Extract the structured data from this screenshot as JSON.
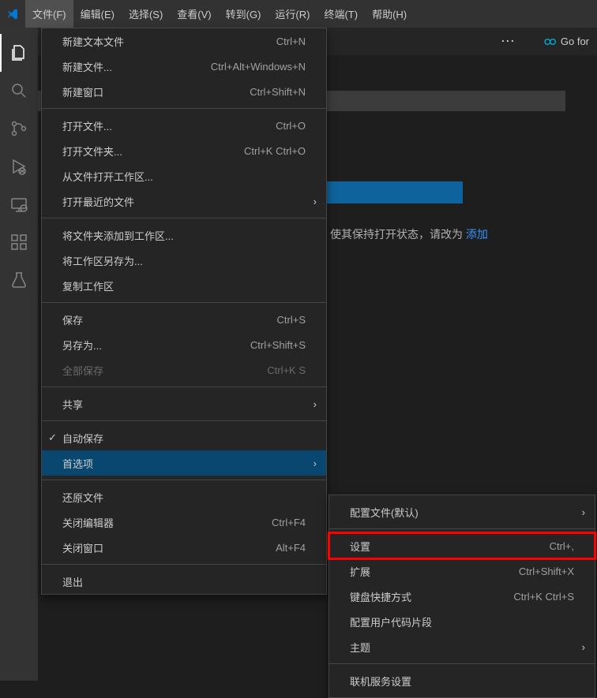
{
  "menubar": {
    "items": [
      {
        "label": "文件(F)"
      },
      {
        "label": "编辑(E)"
      },
      {
        "label": "选择(S)"
      },
      {
        "label": "查看(V)"
      },
      {
        "label": "转到(G)"
      },
      {
        "label": "运行(R)"
      },
      {
        "label": "终端(T)"
      },
      {
        "label": "帮助(H)"
      }
    ]
  },
  "file_menu": {
    "groups": [
      [
        {
          "label": "新建文本文件",
          "shortcut": "Ctrl+N"
        },
        {
          "label": "新建文件...",
          "shortcut": "Ctrl+Alt+Windows+N"
        },
        {
          "label": "新建窗口",
          "shortcut": "Ctrl+Shift+N"
        }
      ],
      [
        {
          "label": "打开文件...",
          "shortcut": "Ctrl+O"
        },
        {
          "label": "打开文件夹...",
          "shortcut": "Ctrl+K Ctrl+O"
        },
        {
          "label": "从文件打开工作区..."
        },
        {
          "label": "打开最近的文件",
          "submenu": true
        }
      ],
      [
        {
          "label": "将文件夹添加到工作区..."
        },
        {
          "label": "将工作区另存为..."
        },
        {
          "label": "复制工作区"
        }
      ],
      [
        {
          "label": "保存",
          "shortcut": "Ctrl+S"
        },
        {
          "label": "另存为...",
          "shortcut": "Ctrl+Shift+S"
        },
        {
          "label": "全部保存",
          "shortcut": "Ctrl+K S",
          "disabled": true
        }
      ],
      [
        {
          "label": "共享",
          "submenu": true
        }
      ],
      [
        {
          "label": "自动保存",
          "checked": true
        },
        {
          "label": "首选项",
          "submenu": true,
          "highlighted": true
        }
      ],
      [
        {
          "label": "还原文件"
        },
        {
          "label": "关闭编辑器",
          "shortcut": "Ctrl+F4"
        },
        {
          "label": "关闭窗口",
          "shortcut": "Alt+F4"
        }
      ],
      [
        {
          "label": "退出"
        }
      ]
    ]
  },
  "preferences_submenu": {
    "groups": [
      [
        {
          "label": "配置文件(默认)",
          "submenu": true
        }
      ],
      [
        {
          "label": "设置",
          "shortcut": "Ctrl+,",
          "red_highlight": true
        },
        {
          "label": "扩展",
          "shortcut": "Ctrl+Shift+X"
        },
        {
          "label": "键盘快捷方式",
          "shortcut": "Ctrl+K Ctrl+S"
        },
        {
          "label": "配置用户代码片段"
        },
        {
          "label": "主题",
          "submenu": true
        }
      ],
      [
        {
          "label": "联机服务设置"
        }
      ]
    ]
  },
  "content": {
    "text_suffix": "使其保持打开状态，请改为 ",
    "link": "添加"
  },
  "tabs": {
    "go_label": "Go for"
  }
}
